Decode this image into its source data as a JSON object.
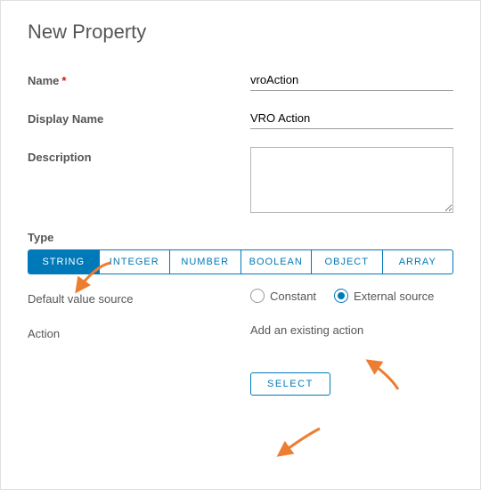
{
  "title": "New Property",
  "fields": {
    "nameLabel": "Name",
    "nameValue": "vroAction",
    "displayNameLabel": "Display Name",
    "displayNameValue": "VRO Action",
    "descriptionLabel": "Description",
    "descriptionValue": ""
  },
  "typeSection": {
    "label": "Type",
    "options": [
      "STRING",
      "INTEGER",
      "NUMBER",
      "BOOLEAN",
      "OBJECT",
      "ARRAY"
    ],
    "selected": "STRING"
  },
  "defaultSource": {
    "label": "Default value source",
    "options": {
      "constant": "Constant",
      "external": "External source"
    },
    "selected": "external"
  },
  "action": {
    "label": "Action",
    "hint": "Add an existing action",
    "button": "SELECT"
  }
}
